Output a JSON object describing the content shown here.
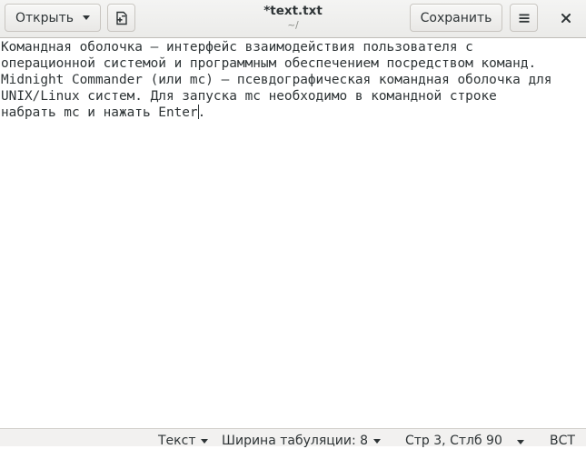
{
  "header": {
    "open_label": "Открыть",
    "save_label": "Сохранить",
    "title": "*text.txt",
    "subtitle": "~/"
  },
  "icons": {
    "open_caret": "chevron-down-icon",
    "new_document": "new-document-icon",
    "menu": "hamburger-menu-icon",
    "close": "close-icon"
  },
  "editor": {
    "lines": [
      "Командная оболочка — интерфейс взаимодействия пользователя с",
      "операционной системой и программным обеспечением посредством команд.",
      "Midnight Commander (или mc) — псевдографическая командная оболочка для",
      "UNIX/Linux систем. Для запуска mc необходимо в командной строке",
      "набрать mc и нажать Enter."
    ],
    "cursor_line": 5,
    "cursor_col": 25
  },
  "statusbar": {
    "language": "Текст",
    "tab_width": "Ширина табуляции: 8",
    "position": "Стр 3, Стлб 90",
    "insert_mode": "ВСТ"
  }
}
